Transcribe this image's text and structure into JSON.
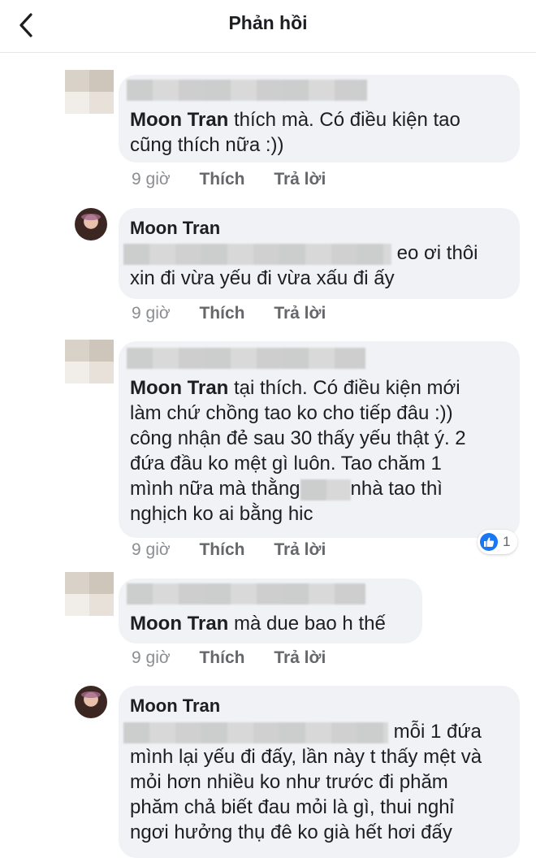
{
  "header": {
    "title": "Phản hồi",
    "back_icon": "chevron-left-icon"
  },
  "comments": [
    {
      "author": "Moon Tran",
      "text": " thích mà. Có điều kiện tao cũng thích nữa :))",
      "text_l1": "thích mà. Có điều kiện tao",
      "text_l2": "cũng thích nữa :))",
      "time": "9 giờ",
      "like": "Thích",
      "reply": "Trả lời"
    },
    {
      "author": "Moon Tran",
      "text_l1": "eo ơi thôi",
      "text_l2": "xin đi vừa yếu đi vừa xấu đi ấy",
      "time": "9 giờ",
      "like": "Thích",
      "reply": "Trả lời"
    },
    {
      "author": "Moon Tran",
      "text_l1": "tại thích. Có điều kiện mới",
      "text_l2": "làm chứ chồng tao ko cho tiếp đâu :))",
      "text_l3": "công nhận đẻ sau 30 thấy yếu thật ý. 2",
      "text_l4": "đứa đầu ko mệt gì luôn. Tao chăm 1",
      "text_l5a": "mình nữa mà thằng",
      "text_l5b": "nhà tao thì",
      "text_l6": "nghịch ko ai bằng hic",
      "reaction_count": "1",
      "time": "9 giờ",
      "like": "Thích",
      "reply": "Trả lời"
    },
    {
      "author": "Moon Tran",
      "text_l1": " mà due bao h thế",
      "time": "9 giờ",
      "like": "Thích",
      "reply": "Trả lời"
    },
    {
      "author": "Moon Tran",
      "text_l1": "mỗi 1 đứa",
      "text_l2": "mình lại yếu đi đấy, lần này t thấy mệt và",
      "text_l3": "mỏi hơn nhiều ko như trước đi phăm",
      "text_l4": "phăm chả biết đau mỏi là gì, thui nghỉ",
      "text_l5": "ngơi hưởng thụ đê ko già hết hơi đấy"
    }
  ]
}
